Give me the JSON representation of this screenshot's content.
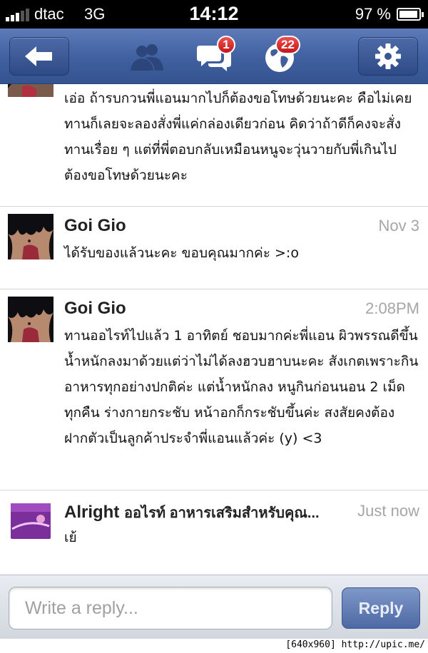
{
  "status_bar": {
    "carrier": "dtac",
    "network": "3G",
    "time": "14:12",
    "battery_percent": "97 %",
    "battery_level": 0.97
  },
  "nav": {
    "back_icon": "back-arrow-icon",
    "friends_icon": "friends-icon",
    "messages_icon": "messages-icon",
    "messages_badge": "1",
    "notifications_icon": "globe-icon",
    "notifications_badge": "22",
    "settings_icon": "gear-icon"
  },
  "messages": [
    {
      "sender": "",
      "time": "",
      "body": "เอ่อ ถ้ารบกวนพี่แอนมากไปก็ต้องขอโทษด้วยนะคะ คือไม่เคยทานก็เลยจะลองสั่งพี่แค่กล่องเดียวก่อน คิดว่าถ้าดีก็คงจะสั่งทานเรื่อย ๆ แต่ที่พี่ตอบกลับเหมือนหนูจะวุ่นวายกับพี่เกินไป ต้องขอโทษด้วยนะคะ"
    },
    {
      "sender": "Goi Gio",
      "time": "Nov 3",
      "body": "ได้รับของแล้วนะคะ ขอบคุณมากค่ะ >:o"
    },
    {
      "sender": "Goi Gio",
      "time": "2:08PM",
      "body": "ทานออไรท์ไปแล้ว 1 อาทิตย์ ชอบมากค่ะพี่แอน ผิวพรรณดีขึ้น น้ำหนักลงมาด้วยแต่ว่าไม่ได้ลงฮวบฮาบนะคะ สังเกตเพราะกินอาหารทุกอย่างปกติค่ะ แต่น้ำหนักลง หนูกินก่อนนอน 2 เม็ดทุกคืน ร่างกายกระชับ หน้าอกก็กระชับขึ้นค่ะ สงสัยคงต้องฝากตัวเป็นลูกค้าประจำพี่แอนแล้วค่ะ (y) <3"
    },
    {
      "sender": "Alright",
      "sender_preview": "ออไรท์ อาหารเสริมสำหรับคุณ...",
      "time": "Just now",
      "body": "เย้"
    }
  ],
  "reply": {
    "placeholder": "Write a reply...",
    "button_label": "Reply"
  },
  "watermark": "[640x960] http://upic.me/",
  "colors": {
    "nav_blue": "#3f5f9f",
    "timestamp_gray": "#a6a6a6",
    "badge_red": "#d42020"
  }
}
